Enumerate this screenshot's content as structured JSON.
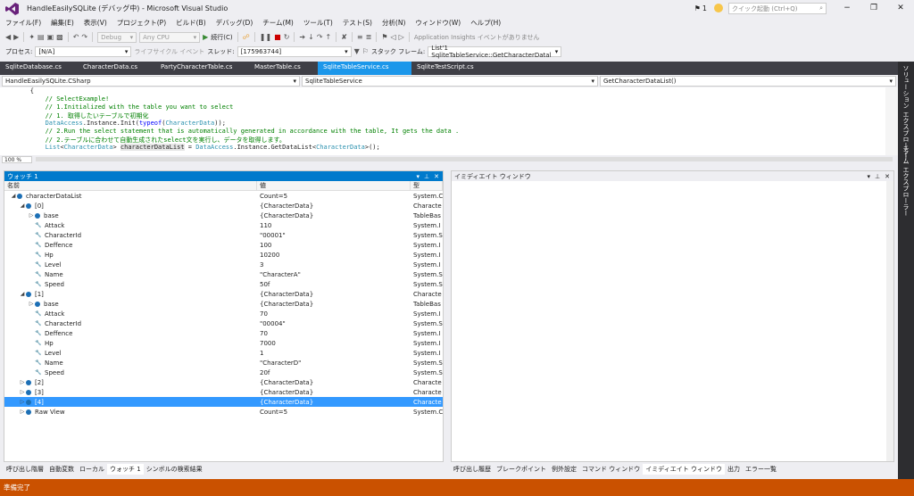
{
  "window": {
    "title": "HandleEasilySQLite (デバッグ中) - Microsoft Visual Studio",
    "notif_count": "1",
    "quick_launch_placeholder": "クイック起動 (Ctrl+Q)"
  },
  "menu": [
    "ファイル(F)",
    "編集(E)",
    "表示(V)",
    "プロジェクト(P)",
    "ビルド(B)",
    "デバッグ(D)",
    "チーム(M)",
    "ツール(T)",
    "テスト(S)",
    "分析(N)",
    "ウィンドウ(W)",
    "ヘルプ(H)"
  ],
  "toolbar1": {
    "config": "Debug",
    "platform": "Any CPU",
    "continue_label": "続行(C)",
    "app_insights": "Application Insights イベントがありません"
  },
  "toolbar2": {
    "process_label": "プロセス:",
    "process_value": "[N/A]",
    "lifecycle_label": "ライフサイクル イベント",
    "thread_label": "スレッド:",
    "thread_value": "[175963744]",
    "stackframe_label": "スタック フレーム:",
    "stackframe_value": "List'1 SqliteTableService::GetCharacterDatal"
  },
  "tabs": [
    {
      "label": "SqliteDatabase.cs",
      "active": false
    },
    {
      "label": "CharacterData.cs",
      "active": false
    },
    {
      "label": "PartyCharacterTable.cs",
      "active": false
    },
    {
      "label": "MasterTable.cs",
      "active": false
    },
    {
      "label": "SqliteTableService.cs",
      "active": true
    },
    {
      "label": "SqliteTestScript.cs",
      "active": false
    }
  ],
  "navbar": {
    "project": "HandleEasilySQLite.CSharp",
    "class": "SqliteTableService",
    "method": "GetCharacterDataList()"
  },
  "code": [
    {
      "indent": "        ",
      "parts": [
        {
          "t": "{",
          "c": ""
        }
      ]
    },
    {
      "indent": "            ",
      "parts": [
        {
          "t": "// SelectExample!",
          "c": "c-cm"
        }
      ]
    },
    {
      "indent": "            ",
      "parts": [
        {
          "t": "// 1.Initialized with the table you want to select",
          "c": "c-cm"
        }
      ]
    },
    {
      "indent": "            ",
      "parts": [
        {
          "t": "// 1. 取得したいテーブルで初期化",
          "c": "c-cm"
        }
      ]
    },
    {
      "indent": "            ",
      "parts": [
        {
          "t": "DataAccess",
          "c": "c-ty"
        },
        {
          "t": ".Instance.Init(",
          "c": ""
        },
        {
          "t": "typeof",
          "c": "c-kw"
        },
        {
          "t": "(",
          "c": ""
        },
        {
          "t": "CharacterData",
          "c": "c-ty"
        },
        {
          "t": "));",
          "c": ""
        }
      ]
    },
    {
      "indent": "            ",
      "parts": [
        {
          "t": "// 2.Run the select statement that is automatically generated in accordance with the table, It gets the data .",
          "c": "c-cm"
        }
      ]
    },
    {
      "indent": "            ",
      "parts": [
        {
          "t": "// 2.テーブルに合わせて自動生成されたselect文を実行し、データを取得します。",
          "c": "c-cm"
        }
      ]
    },
    {
      "indent": "            ",
      "parts": [
        {
          "t": "List",
          "c": "c-ty"
        },
        {
          "t": "<",
          "c": ""
        },
        {
          "t": "CharacterData",
          "c": "c-ty"
        },
        {
          "t": "> ",
          "c": ""
        },
        {
          "t": "characterDataList",
          "c": "c-hl"
        },
        {
          "t": " = ",
          "c": ""
        },
        {
          "t": "DataAccess",
          "c": "c-ty"
        },
        {
          "t": ".Instance.GetDataList<",
          "c": ""
        },
        {
          "t": "CharacterData",
          "c": "c-ty"
        },
        {
          "t": ">();",
          "c": ""
        }
      ]
    }
  ],
  "zoom": "100 %",
  "watch": {
    "title": "ウォッチ 1",
    "headers": {
      "name": "名前",
      "value": "値",
      "type": "型"
    },
    "rows": [
      {
        "level": 0,
        "exp": "◢",
        "icon": "obj",
        "name": "characterDataList",
        "value": "Count=5",
        "type": "System.Co",
        "sel": false
      },
      {
        "level": 1,
        "exp": "◢",
        "icon": "obj",
        "name": "[0]",
        "value": "{CharacterData}",
        "type": "Characte",
        "sel": false
      },
      {
        "level": 2,
        "exp": "▷",
        "icon": "obj",
        "name": "base",
        "value": "{CharacterData}",
        "type": "TableBas",
        "sel": false
      },
      {
        "level": 2,
        "exp": "",
        "icon": "prop",
        "name": "Attack",
        "value": "110",
        "type": "System.I",
        "sel": false
      },
      {
        "level": 2,
        "exp": "",
        "icon": "prop",
        "name": "CharacterId",
        "value": "\"00001\"",
        "type": "System.S",
        "sel": false
      },
      {
        "level": 2,
        "exp": "",
        "icon": "prop",
        "name": "Deffence",
        "value": "100",
        "type": "System.I",
        "sel": false
      },
      {
        "level": 2,
        "exp": "",
        "icon": "prop",
        "name": "Hp",
        "value": "10200",
        "type": "System.I",
        "sel": false
      },
      {
        "level": 2,
        "exp": "",
        "icon": "prop",
        "name": "Level",
        "value": "3",
        "type": "System.I",
        "sel": false
      },
      {
        "level": 2,
        "exp": "",
        "icon": "prop",
        "name": "Name",
        "value": "\"CharacterA\"",
        "type": "System.S",
        "sel": false
      },
      {
        "level": 2,
        "exp": "",
        "icon": "prop",
        "name": "Speed",
        "value": "50f",
        "type": "System.S",
        "sel": false
      },
      {
        "level": 1,
        "exp": "◢",
        "icon": "obj",
        "name": "[1]",
        "value": "{CharacterData}",
        "type": "Characte",
        "sel": false
      },
      {
        "level": 2,
        "exp": "▷",
        "icon": "obj",
        "name": "base",
        "value": "{CharacterData}",
        "type": "TableBas",
        "sel": false
      },
      {
        "level": 2,
        "exp": "",
        "icon": "prop",
        "name": "Attack",
        "value": "70",
        "type": "System.I",
        "sel": false
      },
      {
        "level": 2,
        "exp": "",
        "icon": "prop",
        "name": "CharacterId",
        "value": "\"00004\"",
        "type": "System.S",
        "sel": false
      },
      {
        "level": 2,
        "exp": "",
        "icon": "prop",
        "name": "Deffence",
        "value": "70",
        "type": "System.I",
        "sel": false
      },
      {
        "level": 2,
        "exp": "",
        "icon": "prop",
        "name": "Hp",
        "value": "7000",
        "type": "System.I",
        "sel": false
      },
      {
        "level": 2,
        "exp": "",
        "icon": "prop",
        "name": "Level",
        "value": "1",
        "type": "System.I",
        "sel": false
      },
      {
        "level": 2,
        "exp": "",
        "icon": "prop",
        "name": "Name",
        "value": "\"CharacterD\"",
        "type": "System.S",
        "sel": false
      },
      {
        "level": 2,
        "exp": "",
        "icon": "prop",
        "name": "Speed",
        "value": "20f",
        "type": "System.S",
        "sel": false
      },
      {
        "level": 1,
        "exp": "▷",
        "icon": "obj",
        "name": "[2]",
        "value": "{CharacterData}",
        "type": "Characte",
        "sel": false
      },
      {
        "level": 1,
        "exp": "▷",
        "icon": "obj",
        "name": "[3]",
        "value": "{CharacterData}",
        "type": "Characte",
        "sel": false
      },
      {
        "level": 1,
        "exp": "▷",
        "icon": "obj",
        "name": "[4]",
        "value": "{CharacterData}",
        "type": "Characte",
        "sel": true
      },
      {
        "level": 1,
        "exp": "▷",
        "icon": "obj",
        "name": "Raw View",
        "value": "Count=5",
        "type": "System.Co",
        "sel": false
      }
    ]
  },
  "immediate": {
    "title": "イミディエイト ウィンドウ"
  },
  "left_bottom_tabs": [
    "呼び出し階層",
    "自動変数",
    "ローカル",
    "ウォッチ 1",
    "シンボルの検索結果"
  ],
  "left_bottom_active": 3,
  "right_bottom_tabs": [
    "呼び出し履歴",
    "ブレークポイント",
    "例外設定",
    "コマンド ウィンドウ",
    "イミディエイト ウィンドウ",
    "出力",
    "エラー一覧"
  ],
  "right_bottom_active": 4,
  "status": "準備完了",
  "side": [
    "ソリューション エクスプローラー",
    "チーム エクスプローラー"
  ],
  "colors": {
    "accent": "#007acc",
    "tab_bar": "#3f3f46",
    "status": "#ca5100",
    "selection": "#3399ff"
  }
}
